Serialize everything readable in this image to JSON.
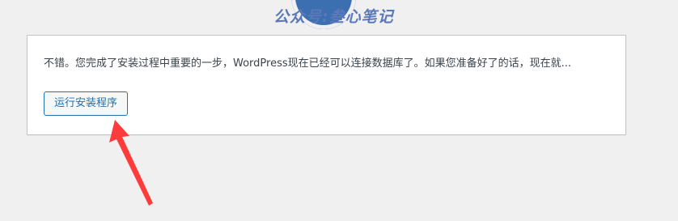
{
  "watermark": {
    "text": "公众号:叁心笔记"
  },
  "setup": {
    "message": "不错。您完成了安装过程中重要的一步，WordPress现在已经可以连接数据库了。如果您准备好了的话，现在就...",
    "run_button_label": "运行安装程序"
  },
  "colors": {
    "page_background": "#f0f0f1",
    "button_accent": "#2271b1",
    "annotation_arrow": "#ff3b3b",
    "watermark": "#5b78b8"
  },
  "icons": {
    "logo": "wordpress-logo-icon",
    "annotation": "red-arrow-icon"
  }
}
